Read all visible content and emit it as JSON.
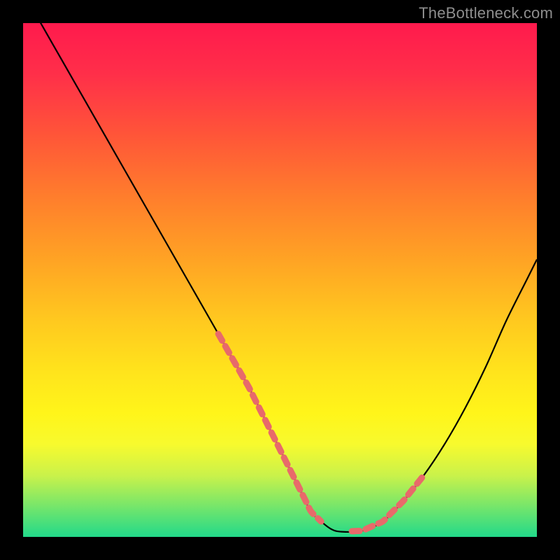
{
  "watermark": "TheBottleneck.com",
  "palette": {
    "frame_bg": "#000000",
    "curve": "#000000",
    "highlight": "#e86a6a",
    "gradient_top": "#ff1a4d",
    "gradient_bottom": "#22d98a"
  },
  "chart_data": {
    "type": "line",
    "title": "",
    "xlabel": "",
    "ylabel": "",
    "xlim": [
      0,
      100
    ],
    "ylim": [
      0,
      100
    ],
    "grid": false,
    "legend": false,
    "series": [
      {
        "name": "bottleneck-curve",
        "x": [
          0,
          4,
          8,
          12,
          16,
          20,
          24,
          28,
          32,
          36,
          40,
          44,
          48,
          50,
          52,
          54,
          56,
          58,
          60,
          62,
          66,
          70,
          74,
          78,
          82,
          86,
          90,
          94,
          98,
          100
        ],
        "y": [
          106,
          99,
          92,
          85,
          78,
          71,
          64,
          57,
          50,
          43,
          36,
          29,
          21,
          17,
          13,
          9,
          5,
          3,
          1.5,
          1,
          1.2,
          3,
          7,
          12,
          18,
          25,
          33,
          42,
          50,
          54
        ]
      }
    ],
    "highlights": [
      {
        "name": "left-cluster",
        "x_range": [
          38,
          58
        ],
        "dash": [
          10,
          6
        ]
      },
      {
        "name": "right-cluster",
        "x_range": [
          64,
          78
        ],
        "dash": [
          10,
          6
        ]
      }
    ],
    "annotations": []
  }
}
